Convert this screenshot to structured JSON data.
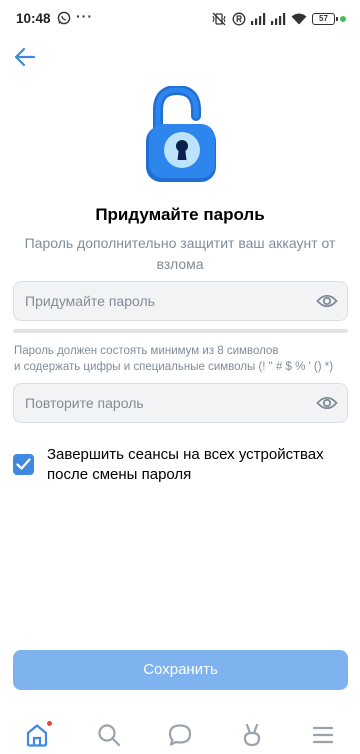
{
  "status_bar": {
    "time": "10:48",
    "more_dots": "···",
    "battery_level": "57"
  },
  "page": {
    "title": "Придумайте пароль",
    "subtitle": "Пароль дополнительно защитит ваш аккаунт от взлома"
  },
  "form": {
    "password_placeholder": "Придумайте пароль",
    "password_value": "",
    "hint_line1": "Пароль должен состоять минимум из 8 символов",
    "hint_line2": "и содержать цифры и специальные символы (! \" # $ % ' () *)",
    "repeat_placeholder": "Повторите пароль",
    "repeat_value": "",
    "strength": 0,
    "checkbox_label": "Завершить сеансы на всех устройствах после смены пароля",
    "checkbox_checked": true,
    "save_label": "Сохранить"
  },
  "icons": {
    "back": "arrow-left-icon",
    "lock": "unlocked-padlock-icon",
    "eye": "eye-icon",
    "tabs": [
      "home-icon",
      "search-icon",
      "messages-icon",
      "clips-icon",
      "menu-icon"
    ]
  },
  "colors": {
    "accent": "#3f8ae0",
    "button_disabled": "#7eb3ef",
    "secondary_text": "#818c99",
    "field_bg": "#f2f3f5",
    "notification_dot": "#e64646"
  }
}
